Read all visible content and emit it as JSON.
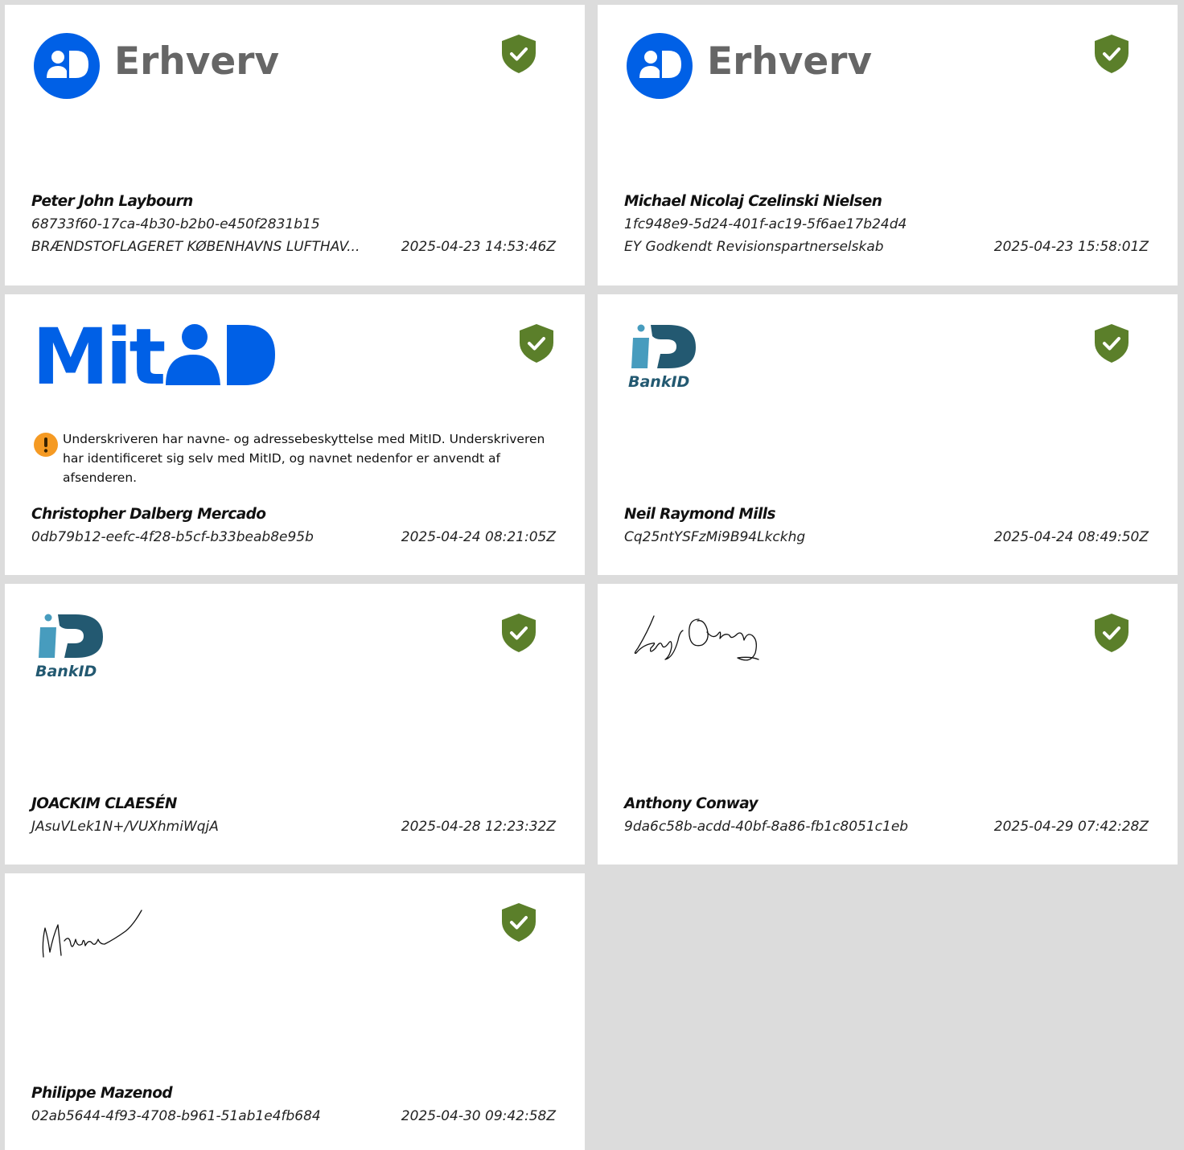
{
  "colors": {
    "background": "#dcdcdc",
    "card": "#ffffff",
    "shield": "#5b7f2a",
    "mitid_blue": "#0060e6",
    "erhverv_gray": "#666666",
    "warning": "#f59a23",
    "bankid_dark": "#235971",
    "bankid_light": "#479cbe"
  },
  "signatures": [
    {
      "method": "mitid-erhverv",
      "logo_text": "Erhverv",
      "verified_icon": "verified-shield-icon",
      "name": "Peter John Laybourn",
      "id": "68733f60-17ca-4b30-b2b0-e450f2831b15",
      "org": "BRÆNDSTOFLAGERET KØBENHAVNS LUFTHAV...",
      "timestamp": "2025-04-23 14:53:46Z"
    },
    {
      "method": "mitid-erhverv",
      "logo_text": "Erhverv",
      "verified_icon": "verified-shield-icon",
      "name": "Michael Nicolaj Czelinski Nielsen",
      "id": "1fc948e9-5d24-401f-ac19-5f6ae17b24d4",
      "org": "EY Godkendt Revisionspartnerselskab",
      "timestamp": "2025-04-23 15:58:01Z"
    },
    {
      "method": "mitid",
      "logo_text": "Mit",
      "verified_icon": "verified-shield-icon",
      "notice": "Underskriveren har navne- og adressebeskyttelse med MitID. Underskriveren har identificeret sig selv med MitID, og navnet nedenfor er anvendt af afsenderen.",
      "name": "Christopher Dalberg Mercado",
      "id": "0db79b12-eefc-4f28-b5cf-b33beab8e95b",
      "timestamp": "2025-04-24 08:21:05Z"
    },
    {
      "method": "bankid",
      "logo_text": "BankID",
      "verified_icon": "verified-shield-icon",
      "name": "Neil Raymond Mills",
      "id": "Cq25ntYSFzMi9B94Lkckhg",
      "timestamp": "2025-04-24 08:49:50Z"
    },
    {
      "method": "bankid",
      "logo_text": "BankID",
      "verified_icon": "verified-shield-icon",
      "name": "JOACKIM CLAESÉN",
      "id": "JAsuVLek1N+/VUXhmiWqjA",
      "timestamp": "2025-04-28 12:23:32Z"
    },
    {
      "method": "handwritten",
      "verified_icon": "verified-shield-icon",
      "name": "Anthony Conway",
      "id": "9da6c58b-acdd-40bf-8a86-fb1c8051c1eb",
      "timestamp": "2025-04-29 07:42:28Z"
    },
    {
      "method": "handwritten",
      "verified_icon": "verified-shield-icon",
      "name": "Philippe Mazenod",
      "id": "02ab5644-4f93-4708-b961-51ab1e4fb684",
      "timestamp": "2025-04-30 09:42:58Z"
    }
  ]
}
